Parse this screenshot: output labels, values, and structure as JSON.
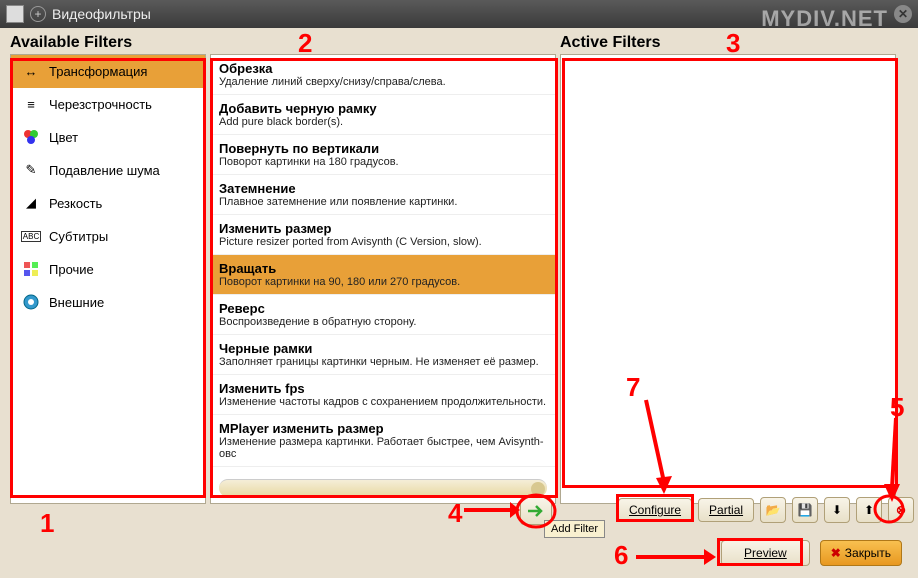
{
  "window": {
    "title": "Видеофильтры"
  },
  "watermark": "MYDIV.NET",
  "headers": {
    "available": "Available Filters",
    "active": "Active Filters"
  },
  "categories": [
    {
      "label": "Трансформация",
      "icon": "transform-icon",
      "selected": true
    },
    {
      "label": "Черезстрочность",
      "icon": "interlace-icon",
      "selected": false
    },
    {
      "label": "Цвет",
      "icon": "color-icon",
      "selected": false
    },
    {
      "label": "Подавление шума",
      "icon": "denoise-icon",
      "selected": false
    },
    {
      "label": "Резкость",
      "icon": "sharpen-icon",
      "selected": false
    },
    {
      "label": "Субтитры",
      "icon": "subtitle-icon",
      "selected": false
    },
    {
      "label": "Прочие",
      "icon": "misc-icon",
      "selected": false
    },
    {
      "label": "Внешние",
      "icon": "external-icon",
      "selected": false
    }
  ],
  "filters": [
    {
      "title": "Обрезка",
      "desc": "Удаление линий сверху/снизу/справа/слева.",
      "selected": false
    },
    {
      "title": "Добавить черную рамку",
      "desc": "Add pure black border(s).",
      "selected": false
    },
    {
      "title": "Повернуть по вертикали",
      "desc": "Поворот картинки на 180 градусов.",
      "selected": false
    },
    {
      "title": "Затемнение",
      "desc": "Плавное затемнение или появление картинки.",
      "selected": false
    },
    {
      "title": "Изменить размер",
      "desc": "Picture resizer ported from Avisynth (C Version, slow).",
      "selected": false
    },
    {
      "title": "Вращать",
      "desc": "Поворот картинки на 90, 180 или 270 градусов.",
      "selected": true
    },
    {
      "title": "Реверс",
      "desc": "Воспроизведение в обратную сторону.",
      "selected": false
    },
    {
      "title": "Черные рамки",
      "desc": "Заполняет границы картинки черным. Не изменяет её размер.",
      "selected": false
    },
    {
      "title": "Изменить fps",
      "desc": "Изменение частоты кадров с сохранением продолжительности.",
      "selected": false
    },
    {
      "title": "MPlayer изменить размер",
      "desc": "Изменение размера картинки. Работает быстрее, чем Avisynth-овс",
      "selected": false
    }
  ],
  "buttons": {
    "configure": "Configure",
    "partial": "Partial",
    "preview": "Preview",
    "close": "Закрыть",
    "add_tooltip": "Add Filter"
  },
  "annotations": {
    "n1": "1",
    "n2": "2",
    "n3": "3",
    "n4": "4",
    "n5": "5",
    "n6": "6",
    "n7": "7"
  }
}
